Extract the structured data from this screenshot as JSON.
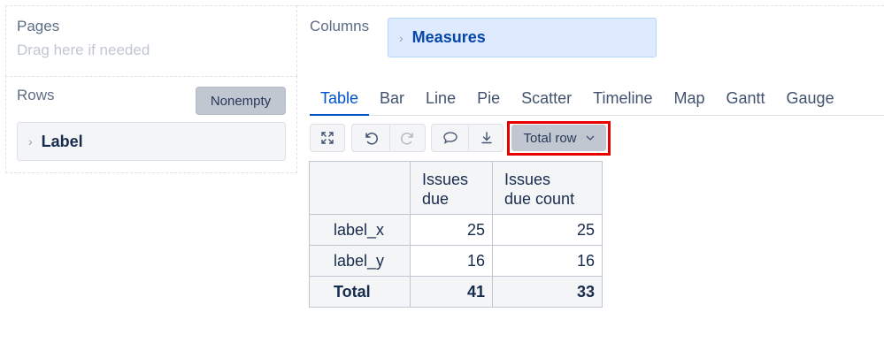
{
  "pages": {
    "title": "Pages",
    "hint": "Drag here if needed"
  },
  "rows": {
    "title": "Rows",
    "nonempty_label": "Nonempty",
    "dimension": "Label"
  },
  "columns": {
    "title": "Columns",
    "dimension": "Measures"
  },
  "tabs": [
    "Table",
    "Bar",
    "Line",
    "Pie",
    "Scatter",
    "Timeline",
    "Map",
    "Gantt",
    "Gauge"
  ],
  "active_tab": "Table",
  "toolbar": {
    "icons": [
      "fullscreen-icon",
      "undo-icon",
      "redo-icon",
      "comment-icon",
      "download-icon"
    ],
    "total_row_label": "Total row"
  },
  "table": {
    "headers": [
      "",
      "Issues\ndue",
      "Issues\ndue count"
    ],
    "rows": [
      {
        "label": "label_x",
        "values": [
          "25",
          "25"
        ]
      },
      {
        "label": "label_y",
        "values": [
          "16",
          "16"
        ]
      }
    ],
    "total": {
      "label": "Total",
      "values": [
        "41",
        "33"
      ]
    }
  },
  "colors": {
    "accent": "#0052cc",
    "highlight": "#e60000",
    "pill_blue": "#deebff"
  }
}
